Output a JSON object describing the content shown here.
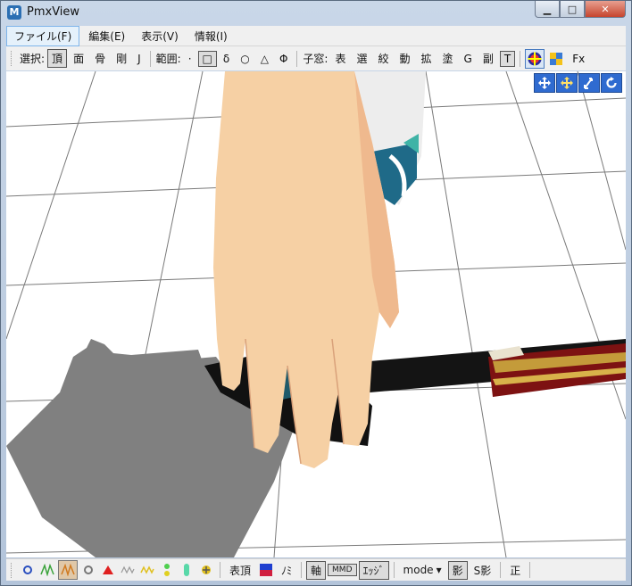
{
  "window": {
    "title": "PmxView",
    "minimize": "▁",
    "maximize": "□",
    "close": "✕",
    "app_icon_letter": "M"
  },
  "menubar": {
    "items": [
      "ファイル(F)",
      "編集(E)",
      "表示(V)",
      "情報(I)"
    ]
  },
  "toolbar": {
    "select_label": "選択:",
    "select_items": [
      "頂",
      "面",
      "骨",
      "剛",
      "J"
    ],
    "range_label": "範囲:",
    "range_items": [
      "·",
      "□",
      "δ",
      "○",
      "△",
      "Φ"
    ],
    "subwin_label": "子窓:",
    "subwin_items": [
      "表",
      "選",
      "絞",
      "動",
      "拡",
      "塗",
      "G",
      "副",
      "T"
    ],
    "fx_label": "Fx"
  },
  "statusbar": {
    "verts_label": "表頂",
    "mi_label": "ﾉﾐ",
    "axis_label": "軸",
    "mmd_label": "MMD",
    "edge_label": "ｴｯｼﾞ",
    "mode_label": "mode",
    "mode_arrow": "▾",
    "shadow_label": "影",
    "sshadow_label": "S影",
    "ortho_label": "正"
  },
  "colors": {
    "skin": "#f6d0a4",
    "skin_shade": "#efb98e",
    "shadow": "#808080",
    "grid": "#7a7a7a",
    "sword_red": "#9c1b1b"
  }
}
